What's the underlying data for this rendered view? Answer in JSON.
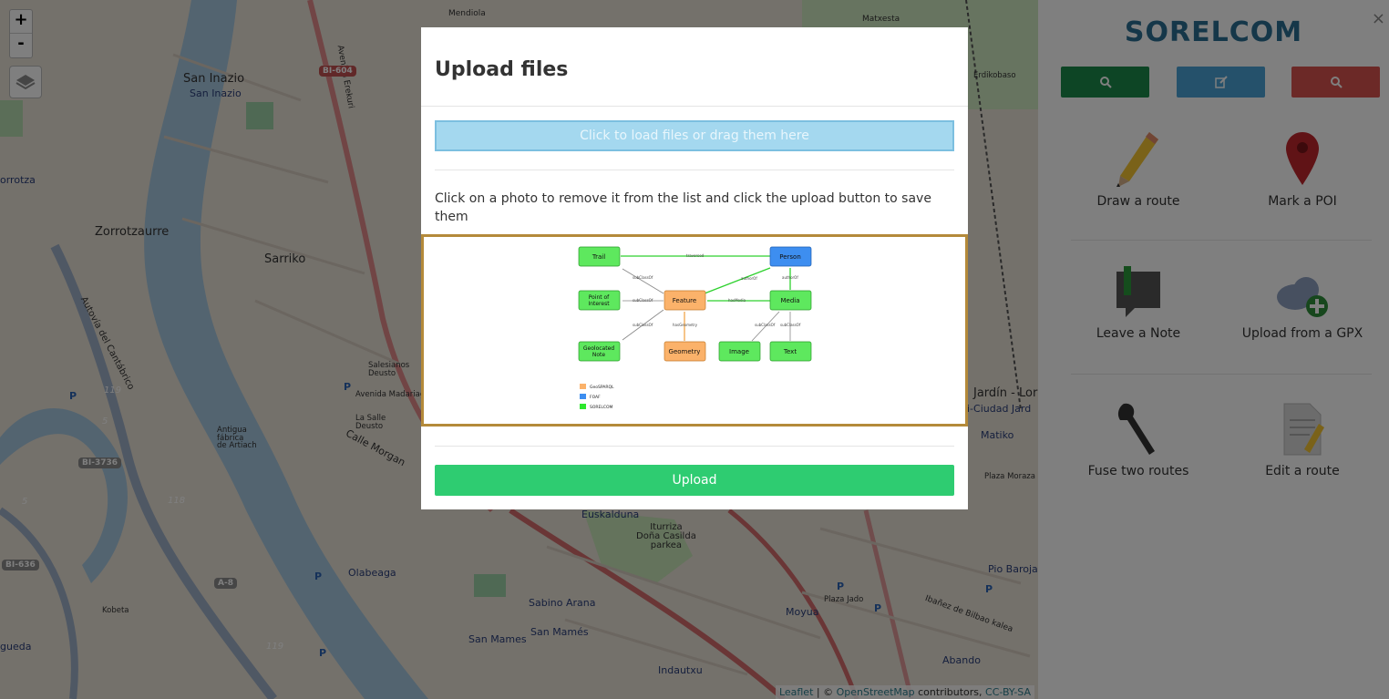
{
  "map": {
    "zoom_in": "+",
    "zoom_out": "-",
    "labels": {
      "mendiola": "Mendiola",
      "matxesta": "Matxesta",
      "erdikobaso": "Erdikobaso",
      "san_inazio_1": "San Inazio",
      "san_inazio_2": "San Inazio",
      "zorrotzaurre": "Zorrotzaurre",
      "sarriko": "Sarriko",
      "orrotza": "orrotza",
      "la_salle": "La Salle\nDeusto",
      "salesianos": "Salesianos\nDeusto",
      "avenida_madariaga": "Avenida Madariaga",
      "calle_morgan": "Calle Morgan",
      "antigua": "Antigua\nfábrica\nde Artiach",
      "olabeaga": "Olabeaga",
      "kobeta": "Kobeta",
      "gueda": "gueda",
      "iturriza": "Iturriza\nDoña Casilda\nparkea",
      "euskalduna": "Euskalduna",
      "sabino_arana": "Sabino Arana",
      "san_mames_1": "San Mamés",
      "san_mames_2": "San Mames",
      "indautxu": "Indautxu",
      "moyua": "Moyua",
      "abando": "Abando",
      "matiko": "Matiko",
      "jardin_loru": "Jardín - Loru",
      "ciudad_jard": "i-Ciudad Jard",
      "plaza_moraza": "Plaza Moraza",
      "pio_baroja": "Pio Baroja",
      "ibanez": "Ibañez de Bilbao kalea",
      "plaza_jado": "Plaza Jado",
      "avenida_erekuri": "Avenida Erekuri",
      "autovia": "Autovía del Cantábrico"
    },
    "shields": {
      "bi604": "BI-604",
      "bi3736": "BI-3736",
      "bi636": "BI-636",
      "a8": "A-8"
    },
    "route_numbers": {
      "n119a": "119",
      "n5a": "5",
      "n118": "118",
      "n5b": "5",
      "n119b": "119"
    },
    "attribution": {
      "leaflet": "Leaflet",
      "sep": " | © ",
      "osm": "OpenStreetMap",
      "contributors": " contributors, ",
      "license": "CC-BY-SA"
    }
  },
  "sidebar": {
    "brand": "SORELCOM",
    "close": "×",
    "tabs": [
      {
        "color": "#1a8a4a",
        "icon": "search-icon"
      },
      {
        "color": "#4aa3d6",
        "icon": "edit-icon"
      },
      {
        "color": "#d9534f",
        "icon": "search-icon"
      }
    ],
    "tools": [
      {
        "label": "Draw a route",
        "icon": "pencil-icon"
      },
      {
        "label": "Mark a POI",
        "icon": "map-marker-icon"
      },
      {
        "label": "Leave a Note",
        "icon": "note-icon"
      },
      {
        "label": "Upload from a GPX",
        "icon": "cloud-upload-icon"
      },
      {
        "label": "Fuse two routes",
        "icon": "wrench-icon"
      },
      {
        "label": "Edit a route",
        "icon": "edit-document-icon"
      }
    ]
  },
  "modal": {
    "title": "Upload files",
    "dropzone": "Click to load files or drag them here",
    "instructions": "Click on a photo to remove it from the list and click the upload button to save them",
    "upload_button": "Upload",
    "diagram": {
      "nodes": {
        "trail": "Trail",
        "person": "Person",
        "poi": "Point of\nInterest",
        "feature": "Feature",
        "media": "Media",
        "note": "Geolocated\nNote",
        "geometry": "Geometry",
        "image": "Image",
        "text": "Text"
      },
      "edges": {
        "traversed": "traversed",
        "authorOf1": "authorOf",
        "authorOf2": "authorOf",
        "subClassOf1": "subClassOf",
        "subClassOf2": "subClassOf",
        "subClassOf3": "subClassOf",
        "subClassOf4": "subClassOf",
        "subClassOf5": "subClassOf",
        "hasMedia": "hasMedia",
        "hasGeometry": "hasGeometry"
      },
      "legend": [
        {
          "label": "GeoSPARQL",
          "color": "#fbb26a"
        },
        {
          "label": "FOAF",
          "color": "#3d8ef0"
        },
        {
          "label": "SORELCOM",
          "color": "#2ee82e"
        }
      ]
    }
  }
}
